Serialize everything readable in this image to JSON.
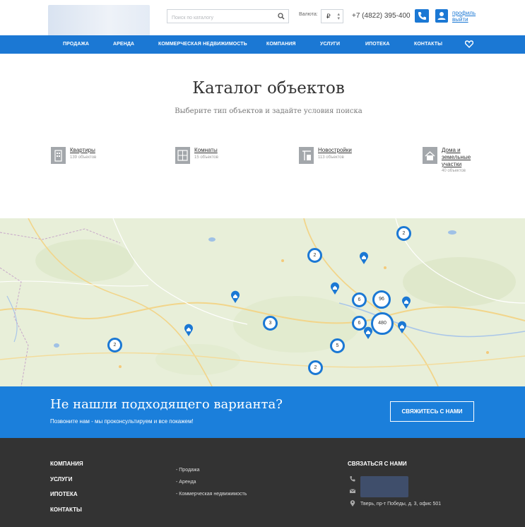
{
  "header": {
    "search_placeholder": "Поиск по каталогу",
    "currency_label": "Валюта:",
    "currency_value": "₽",
    "phone": "+7 (4822) 395-400",
    "profile_link": "профиль",
    "logout_link": "выйти"
  },
  "nav": {
    "items": [
      "ПРОДАЖА",
      "АРЕНДА",
      "КОММЕРЧЕСКАЯ НЕДВИЖИМОСТЬ",
      "КОМПАНИЯ",
      "УСЛУГИ",
      "ИПОТЕКА",
      "КОНТАКТЫ"
    ]
  },
  "catalog": {
    "title": "Каталог объектов",
    "subtitle": "Выберите тип объектов и задайте условия поиска",
    "categories": [
      {
        "name": "Квартиры",
        "count": "139 объектов",
        "icon": "building-icon"
      },
      {
        "name": "Комнаты",
        "count": "15 объектов",
        "icon": "room-icon"
      },
      {
        "name": "Новостройки",
        "count": "113 объектов",
        "icon": "crane-icon"
      },
      {
        "name_line1": "Дома и",
        "name_line2": "земельные",
        "name_line3": "участки",
        "count": "40 объектов",
        "icon": "house-icon"
      }
    ]
  },
  "map": {
    "clusters": [
      "2",
      "2",
      "3",
      "5",
      "6",
      "96",
      "6",
      "480",
      "2",
      "2"
    ]
  },
  "cta": {
    "title": "Не нашли подходящего варианта?",
    "subtitle": "Позвоните нам - мы проконсультируем и все покажем!",
    "button": "СВЯЖИТЕСЬ С НАМИ"
  },
  "footer": {
    "menu": [
      "КОМПАНИЯ",
      "УСЛУГИ",
      "ИПОТЕКА",
      "КОНТАКТЫ"
    ],
    "links": [
      "- Продажа",
      "- Аренда",
      "- Коммерческая недвижимость"
    ],
    "contact_title": "СВЯЗАТЬСЯ С НАМИ",
    "address": "Тверь, пр-т Победы, д. 3, офис 501"
  },
  "colors": {
    "brand_blue": "#1b78d4",
    "footer_bg": "#333333"
  }
}
